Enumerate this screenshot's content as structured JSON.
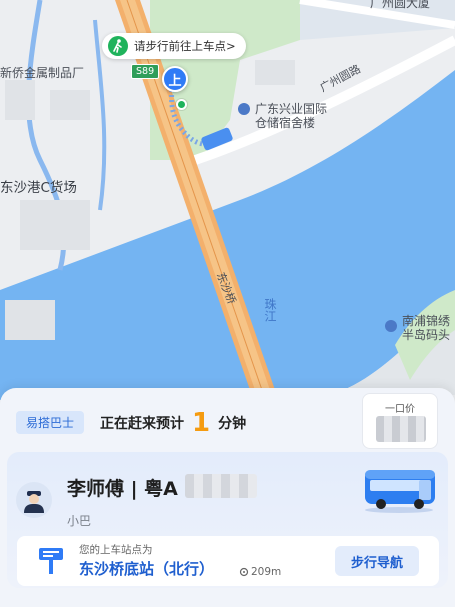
{
  "map": {
    "walk_tip": "请步行前往上车点>",
    "pickup_pin": "上",
    "road_badge": "S89",
    "labels": {
      "factory": "新侨金属制品厂",
      "freight": "东沙港C货场",
      "bank_dorm_line1": "广东兴业国际",
      "bank_dorm_line2": "仓储宿舍楼",
      "road": "广州圆路",
      "bridge": "东沙桥",
      "river": "珠江",
      "pier_line1": "南浦锦绣",
      "pier_line2": "半岛码头",
      "building_top": "广州圆大厦"
    }
  },
  "sheet": {
    "tag": "易搭巴士",
    "status_text": "正在赶来预计",
    "eta_minutes": "1",
    "eta_unit": "分钟",
    "price_label": "一口价",
    "driver_name": "李师傅 | 粤A",
    "vehicle_type": "小巴",
    "station_caption": "您的上车站点为",
    "station_name": "东沙桥底站（北行）",
    "station_distance": "209m",
    "nav_button": "步行导航"
  },
  "colors": {
    "accent_blue": "#2f7bf6",
    "eta_orange": "#f59b10",
    "river": "#74b4f2",
    "bridge": "#f3b06c"
  }
}
